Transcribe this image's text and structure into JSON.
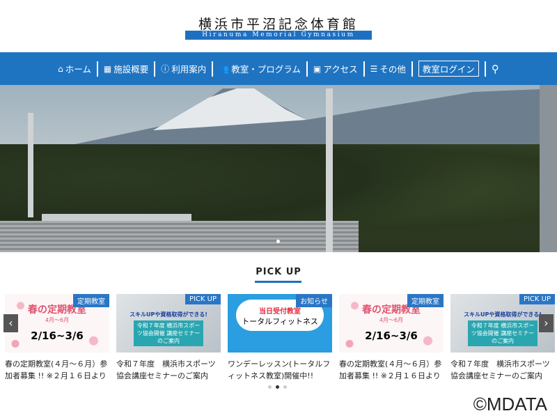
{
  "header": {
    "title": "横浜市平沼記念体育館",
    "subtitle": "Hiranuma Memorial Gymnasium"
  },
  "nav": {
    "items": [
      {
        "label": "ホーム",
        "icon": "home-icon",
        "glyph": "⌂"
      },
      {
        "label": "施設概要",
        "icon": "building-icon",
        "glyph": "▦"
      },
      {
        "label": "利用案内",
        "icon": "info-icon",
        "glyph": "ⓘ"
      },
      {
        "label": "教室・プログラム",
        "icon": "people-icon",
        "glyph": "👥"
      },
      {
        "label": "アクセス",
        "icon": "bus-icon",
        "glyph": "▣"
      },
      {
        "label": "その他",
        "icon": "list-icon",
        "glyph": "☰"
      }
    ],
    "login": "教室ログイン",
    "search_glyph": "⚲"
  },
  "pickup": {
    "heading": "PICK UP",
    "cards": [
      {
        "tag": "定期教室",
        "img_title": "春の定期教室",
        "img_sub": "4月〜6月",
        "img_date": "2/16~3/6",
        "title": "春の定期教室(４月～６月）参加者募集 !! ※２月１６日より"
      },
      {
        "tag": "PICK UP",
        "img_title": "スキルUPや資格取得ができる!",
        "img_sub": "令和７年度 横浜市スポーツ協会開催 講座セミナーのご案内",
        "title": "令和７年度　横浜市スポーツ協会講座セミナーのご案内"
      },
      {
        "tag": "お知らせ",
        "img_title": "当日受付教室",
        "img_sub": "トータルフィットネス",
        "title": "ワンデーレッスン(トータルフィットネス教室)開催中!!"
      },
      {
        "tag": "定期教室",
        "img_title": "春の定期教室",
        "img_sub": "4月〜6月",
        "img_date": "2/16~3/6",
        "title": "春の定期教室(４月～６月）参加者募集 !! ※２月１６日より"
      },
      {
        "tag": "PICK UP",
        "img_title": "スキルUPや資格取得ができる!",
        "img_sub": "令和７年度 横浜市スポーツ協会開催 講座セミナーのご案内",
        "title": "令和７年度　横浜市スポーツ協会講座セミナーのご案内"
      }
    ],
    "prev": "‹",
    "next": "›"
  },
  "copyright": "©MDATA"
}
